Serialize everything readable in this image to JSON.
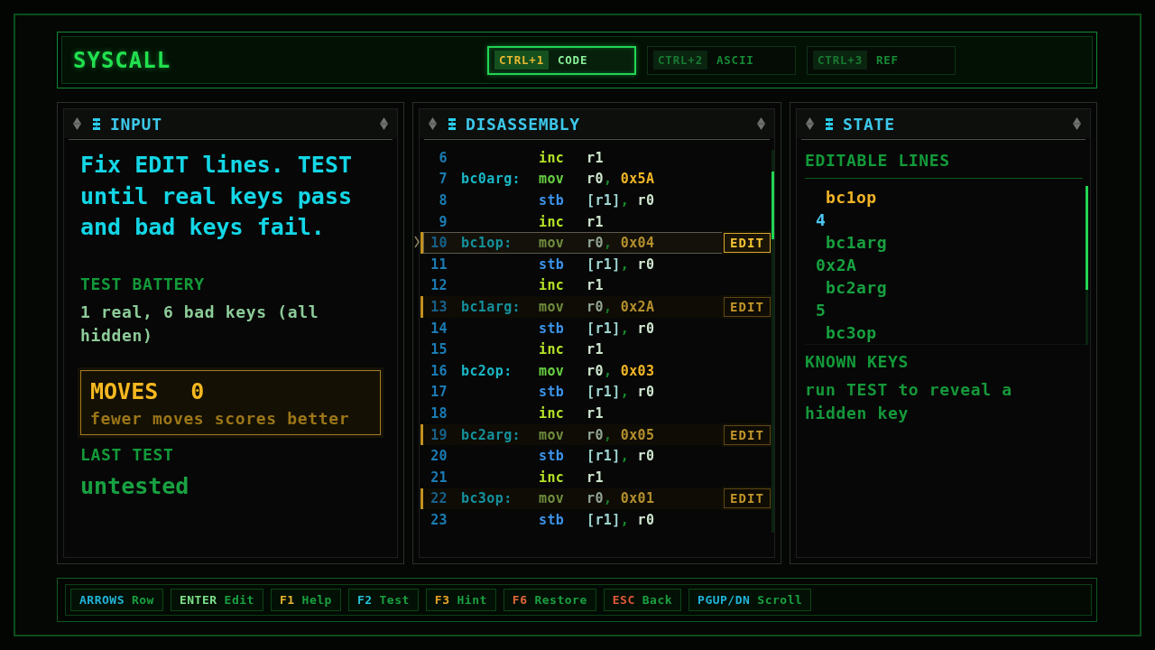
{
  "app": {
    "title": "SYSCALL"
  },
  "tabs": [
    {
      "key": "CTRL+1",
      "label": "CODE",
      "selected": true
    },
    {
      "key": "CTRL+2",
      "label": "ASCII",
      "selected": false
    },
    {
      "key": "CTRL+3",
      "label": "REF",
      "selected": false
    }
  ],
  "input_panel": {
    "title": "INPUT",
    "instructions": "Fix EDIT lines. TEST until real keys pass and bad keys fail.",
    "test_battery": {
      "heading": "TEST BATTERY",
      "text": "1 real, 6 bad keys (all hidden)"
    },
    "moves": {
      "label": "MOVES",
      "value": "0",
      "hint": "fewer moves scores better"
    },
    "last_test": {
      "heading": "LAST TEST",
      "value": "untested"
    }
  },
  "disassembly_panel": {
    "title": "DISASSEMBLY",
    "rows": [
      {
        "line": "6",
        "op": "inc",
        "kind": "arith",
        "operands": [
          {
            "kind": "register",
            "text": "r1"
          }
        ],
        "editable": false,
        "selected": false
      },
      {
        "line": "7",
        "label": "bc0arg:",
        "op": "mov",
        "kind": "move",
        "operands": [
          {
            "kind": "register",
            "text": "r0"
          },
          {
            "kind": "separator",
            "text": ","
          },
          {
            "kind": "immediate",
            "text": "0x5A"
          }
        ],
        "editable": false,
        "selected": false
      },
      {
        "line": "8",
        "op": "stb",
        "kind": "store",
        "operands": [
          {
            "kind": "memory",
            "text": "[r1]"
          },
          {
            "kind": "separator",
            "text": ","
          },
          {
            "kind": "register",
            "text": "r0"
          }
        ],
        "editable": false,
        "selected": false
      },
      {
        "line": "9",
        "op": "inc",
        "kind": "arith",
        "operands": [
          {
            "kind": "register",
            "text": "r1"
          }
        ],
        "editable": false,
        "selected": false
      },
      {
        "line": "10",
        "label": "bc1op:",
        "op": "mov",
        "kind": "move",
        "operands": [
          {
            "kind": "register",
            "text": "r0"
          },
          {
            "kind": "separator",
            "text": ","
          },
          {
            "kind": "immediate",
            "text": "0x04"
          }
        ],
        "editable": true,
        "selected": true,
        "button": "EDIT"
      },
      {
        "line": "11",
        "op": "stb",
        "kind": "store",
        "operands": [
          {
            "kind": "memory",
            "text": "[r1]"
          },
          {
            "kind": "separator",
            "text": ","
          },
          {
            "kind": "register",
            "text": "r0"
          }
        ],
        "editable": false,
        "selected": false
      },
      {
        "line": "12",
        "op": "inc",
        "kind": "arith",
        "operands": [
          {
            "kind": "register",
            "text": "r1"
          }
        ],
        "editable": false,
        "selected": false
      },
      {
        "line": "13",
        "label": "bc1arg:",
        "op": "mov",
        "kind": "move",
        "operands": [
          {
            "kind": "register",
            "text": "r0"
          },
          {
            "kind": "separator",
            "text": ","
          },
          {
            "kind": "immediate",
            "text": "0x2A"
          }
        ],
        "editable": true,
        "selected": false,
        "button": "EDIT"
      },
      {
        "line": "14",
        "op": "stb",
        "kind": "store",
        "operands": [
          {
            "kind": "memory",
            "text": "[r1]"
          },
          {
            "kind": "separator",
            "text": ","
          },
          {
            "kind": "register",
            "text": "r0"
          }
        ],
        "editable": false,
        "selected": false
      },
      {
        "line": "15",
        "op": "inc",
        "kind": "arith",
        "operands": [
          {
            "kind": "register",
            "text": "r1"
          }
        ],
        "editable": false,
        "selected": false
      },
      {
        "line": "16",
        "label": "bc2op:",
        "op": "mov",
        "kind": "move",
        "operands": [
          {
            "kind": "register",
            "text": "r0"
          },
          {
            "kind": "separator",
            "text": ","
          },
          {
            "kind": "immediate",
            "text": "0x03"
          }
        ],
        "editable": false,
        "selected": false
      },
      {
        "line": "17",
        "op": "stb",
        "kind": "store",
        "operands": [
          {
            "kind": "memory",
            "text": "[r1]"
          },
          {
            "kind": "separator",
            "text": ","
          },
          {
            "kind": "register",
            "text": "r0"
          }
        ],
        "editable": false,
        "selected": false
      },
      {
        "line": "18",
        "op": "inc",
        "kind": "arith",
        "operands": [
          {
            "kind": "register",
            "text": "r1"
          }
        ],
        "editable": false,
        "selected": false
      },
      {
        "line": "19",
        "label": "bc2arg:",
        "op": "mov",
        "kind": "move",
        "operands": [
          {
            "kind": "register",
            "text": "r0"
          },
          {
            "kind": "separator",
            "text": ","
          },
          {
            "kind": "immediate",
            "text": "0x05"
          }
        ],
        "editable": true,
        "selected": false,
        "button": "EDIT"
      },
      {
        "line": "20",
        "op": "stb",
        "kind": "store",
        "operands": [
          {
            "kind": "memory",
            "text": "[r1]"
          },
          {
            "kind": "separator",
            "text": ","
          },
          {
            "kind": "register",
            "text": "r0"
          }
        ],
        "editable": false,
        "selected": false
      },
      {
        "line": "21",
        "op": "inc",
        "kind": "arith",
        "operands": [
          {
            "kind": "register",
            "text": "r1"
          }
        ],
        "editable": false,
        "selected": false
      },
      {
        "line": "22",
        "label": "bc3op:",
        "op": "mov",
        "kind": "move",
        "operands": [
          {
            "kind": "register",
            "text": "r0"
          },
          {
            "kind": "separator",
            "text": ","
          },
          {
            "kind": "immediate",
            "text": "0x01"
          }
        ],
        "editable": true,
        "selected": false,
        "button": "EDIT"
      },
      {
        "line": "23",
        "op": "stb",
        "kind": "store",
        "operands": [
          {
            "kind": "memory",
            "text": "[r1]"
          },
          {
            "kind": "separator",
            "text": ","
          },
          {
            "kind": "register",
            "text": "r0"
          }
        ],
        "editable": false,
        "selected": false
      }
    ]
  },
  "state_panel": {
    "title": "STATE",
    "editable_lines": {
      "heading": "EDITABLE LINES",
      "items": [
        {
          "name": "bc1op",
          "value": "4",
          "selected": true
        },
        {
          "name": "bc1arg",
          "value": "0x2A",
          "selected": false
        },
        {
          "name": "bc2arg",
          "value": "5",
          "selected": false
        },
        {
          "name": "bc3op",
          "selected": false
        }
      ]
    },
    "known_keys": {
      "heading": "KNOWN KEYS",
      "text": "run TEST to reveal a hidden key"
    }
  },
  "key_hints": [
    {
      "key": "ARROWS",
      "label": "Row",
      "color": "#22b4d8"
    },
    {
      "key": "ENTER",
      "label": "Edit",
      "color": "#7ee08a"
    },
    {
      "key": "F1",
      "label": "Help",
      "color": "#e6b432"
    },
    {
      "key": "F2",
      "label": "Test",
      "color": "#22c4d8"
    },
    {
      "key": "F3",
      "label": "Hint",
      "color": "#e6a22a"
    },
    {
      "key": "F6",
      "label": "Restore",
      "color": "#e2683a"
    },
    {
      "key": "ESC",
      "label": "Back",
      "color": "#e2583a"
    },
    {
      "key": "PGUP/DN",
      "label": "Scroll",
      "color": "#22b4d8"
    }
  ]
}
